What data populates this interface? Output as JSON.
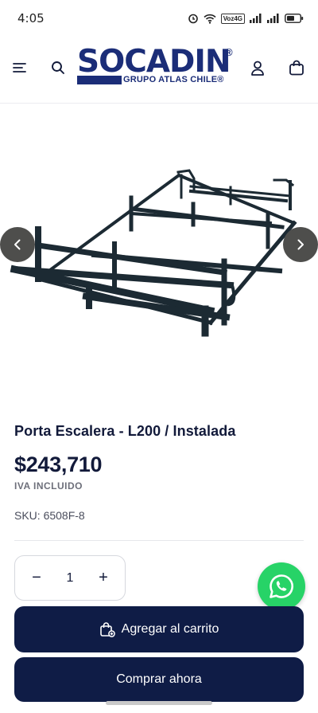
{
  "status_bar": {
    "time": "4:05",
    "volte_label": "Voz4G"
  },
  "header": {
    "logo_main": "SOCADIN",
    "logo_reg": "®",
    "logo_sub": "GRUPO ATLAS CHILE®"
  },
  "product": {
    "title": "Porta Escalera - L200 / Instalada",
    "price": "$243,710",
    "tax_note": "IVA INCLUIDO",
    "sku": "SKU: 6508F-8"
  },
  "quantity": {
    "minus": "−",
    "value": "1",
    "plus": "+"
  },
  "buttons": {
    "add_to_cart": "Agregar al carrito",
    "buy_now": "Comprar ahora"
  },
  "colors": {
    "brand_navy": "#0f1c46",
    "logo_blue": "#1b2d78",
    "whatsapp_green": "#27d367"
  },
  "icons": {
    "menu": "hamburger-icon",
    "search": "search-icon",
    "account": "user-icon",
    "cart": "shopping-bag-icon",
    "prev": "chevron-left-icon",
    "next": "chevron-right-icon",
    "whatsapp": "whatsapp-icon",
    "add_cart": "cart-plus-icon"
  }
}
